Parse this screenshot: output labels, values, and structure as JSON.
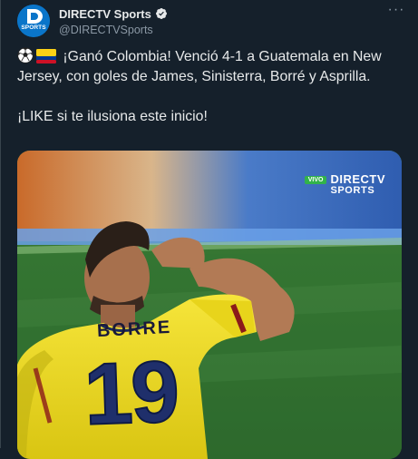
{
  "account": {
    "name": "DIRECTV Sports",
    "handle": "@DIRECTVSports",
    "avatar_text": "SPORTS",
    "verified": true,
    "verified_color": "#1d9bf0"
  },
  "menu": {
    "more_label": "···",
    "more_icon": "more-horizontal-icon"
  },
  "tweet": {
    "line1": "¡Ganó Colombia! Venció 4-1 a Guatemala en New Jersey, con goles de James, Sinisterra, Borré y Asprilla.",
    "line2": "¡LIKE si te ilusiona este inicio!",
    "emojis": [
      "soccer-ball-icon",
      "colombia-flag-icon"
    ]
  },
  "media": {
    "broadcast_badge": "VIVO",
    "broadcast_logo_line1": "DIRECTV",
    "broadcast_logo_line2": "SPORTS",
    "jersey_name": "BORRE",
    "jersey_number": "19",
    "jersey_color": "#f4e21f",
    "pitch_color": "#2e6f2f"
  },
  "colors": {
    "background": "#15202b",
    "text": "#e7e9ea",
    "secondary_text": "#8b98a5",
    "brand_blue": "#0a75c9"
  }
}
